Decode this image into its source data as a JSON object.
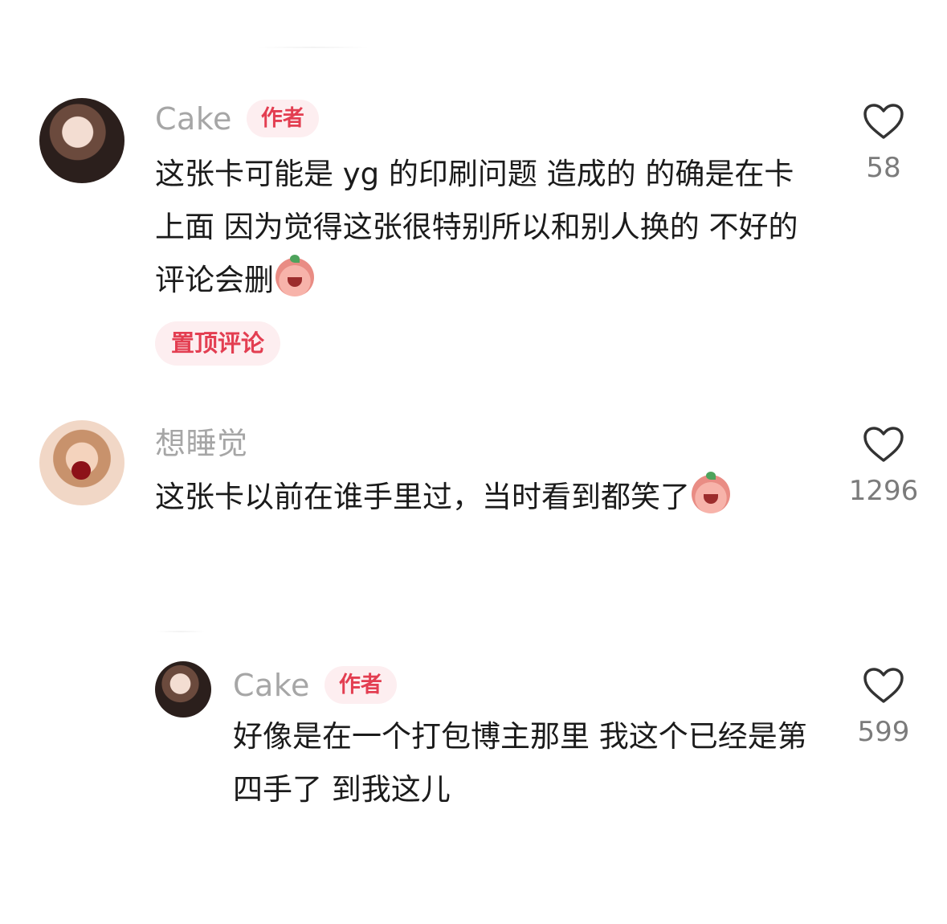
{
  "comments": [
    {
      "username": "Cake",
      "badge": "作者",
      "text": "这张卡可能是 yg 的印刷问题  造成的 的确是在卡上面 因为觉得这张很特别所以和别人换的 不好的评论会删",
      "pinned_label": "置顶评论",
      "likes": "58"
    },
    {
      "username": "想睡觉",
      "text": "这张卡以前在谁手里过，当时看到都笑了",
      "likes": "1296"
    },
    {
      "username": "Cake",
      "badge": "作者",
      "text": "好像是在一个打包博主那里 我这个已经是第四手了 到我这儿",
      "likes": "599"
    }
  ],
  "icons": {
    "heart": "heart-outline-icon",
    "emoji": "crying-peach-emoji"
  },
  "colors": {
    "badge_bg": "#fdeef0",
    "badge_text": "#e33e51",
    "username": "#a6a6a6",
    "body_text": "#1b1b1b",
    "like_count": "#7b7b7b"
  }
}
